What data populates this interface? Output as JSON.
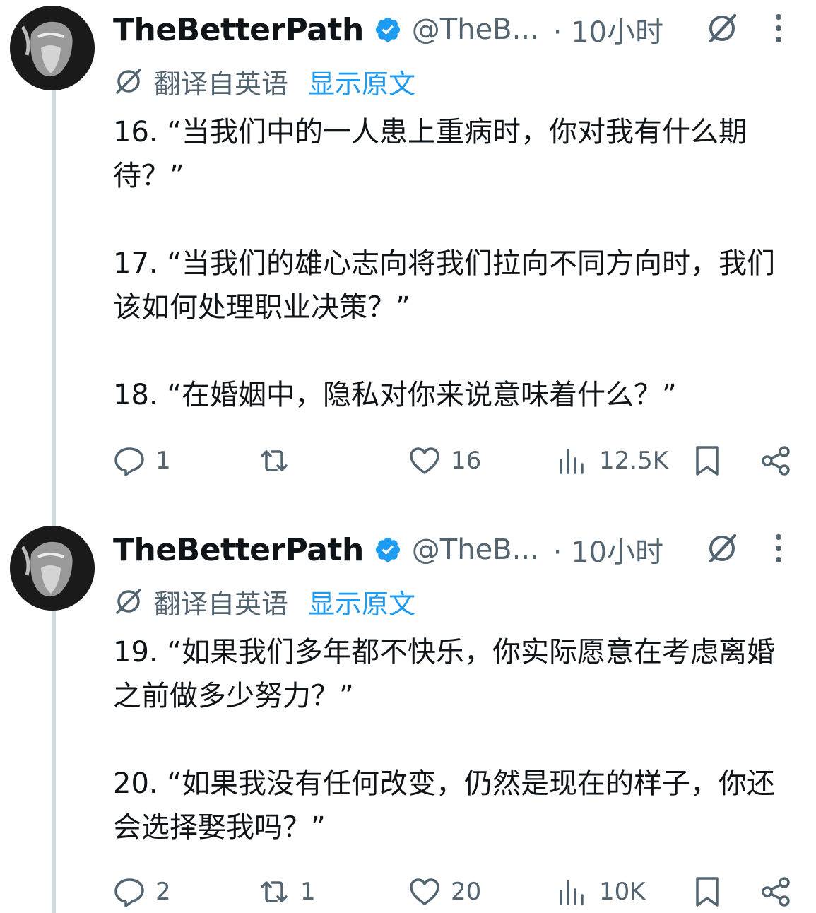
{
  "tweets": [
    {
      "author": {
        "name": "TheBetterPath",
        "handle": "@TheB...",
        "time": "· 10小时"
      },
      "translate": {
        "label": "翻译自英语",
        "show_original": "显示原文"
      },
      "paragraphs": [
        "16. “当我们中的一人患上重病时，你对我有什么期待？”",
        "17. “当我们的雄心志向将我们拉向不同方向时，我们该如何处理职业决策？”",
        "18. “在婚姻中，隐私对你来说意味着什么？”"
      ],
      "actions": {
        "replies": "1",
        "reposts": "",
        "likes": "16",
        "views": "12.5K"
      }
    },
    {
      "author": {
        "name": "TheBetterPath",
        "handle": "@TheB...",
        "time": "· 10小时"
      },
      "translate": {
        "label": "翻译自英语",
        "show_original": "显示原文"
      },
      "paragraphs": [
        "19. “如果我们多年都不快乐，你实际愿意在考虑离婚之前做多少努力？”",
        "20. “如果我没有任何改变，仍然是现在的样子，你还会选择娶我吗？”"
      ],
      "actions": {
        "replies": "2",
        "reposts": "1",
        "likes": "20",
        "views": "10K"
      }
    }
  ],
  "colors": {
    "text": "#0f1419",
    "secondary": "#536471",
    "link": "#1d9bf0",
    "verified": "#1d9bf0",
    "thread_line": "#cfd9de"
  },
  "icons": [
    "avatar",
    "verified-badge-icon",
    "grok-icon",
    "more-icon",
    "translate-icon",
    "reply-icon",
    "repost-icon",
    "like-icon",
    "views-icon",
    "bookmark-icon",
    "share-icon"
  ]
}
